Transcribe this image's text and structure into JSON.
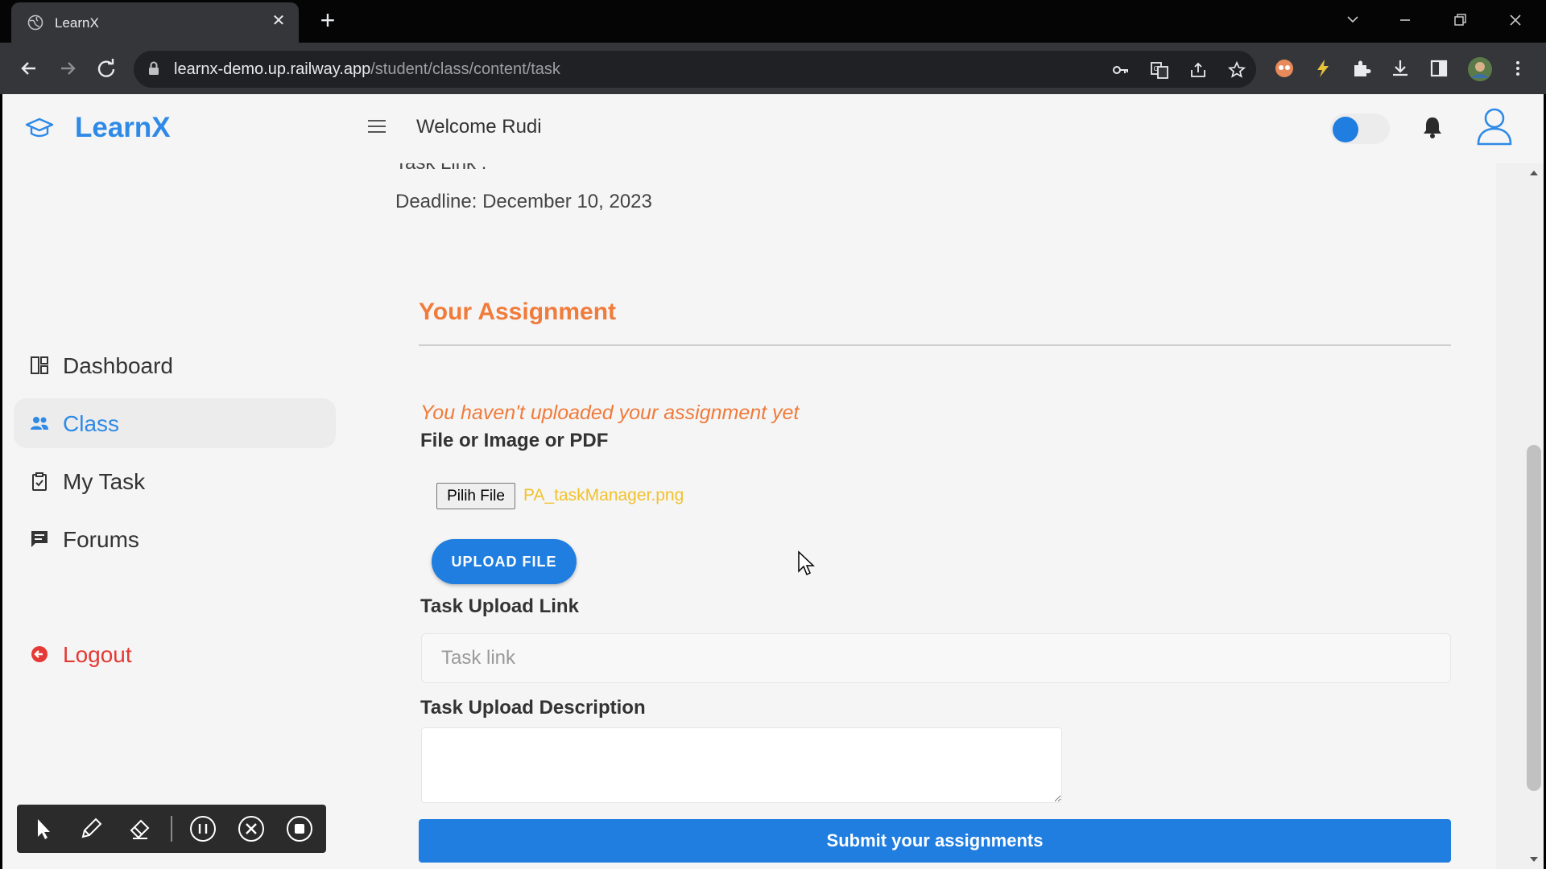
{
  "browser": {
    "tab_title": "LearnX",
    "tab_close": "✕",
    "new_tab": "+",
    "url_host": "learnx-demo.up.railway.app",
    "url_path": "/student/class/content/task"
  },
  "app": {
    "logo_text": "LearnX",
    "welcome": "Welcome Rudi",
    "accent_color": "#2e8ae6",
    "orange_color": "#f07b3a"
  },
  "sidebar": {
    "items": [
      {
        "label": "Dashboard",
        "icon": "dashboard-icon"
      },
      {
        "label": "Class",
        "icon": "users-icon",
        "active": true
      },
      {
        "label": "My Task",
        "icon": "clipboard-icon"
      },
      {
        "label": "Forums",
        "icon": "chat-icon"
      },
      {
        "label": "Logout",
        "icon": "logout-icon"
      }
    ]
  },
  "main": {
    "task_link_partial": "Task Link :",
    "deadline": "Deadline: December 10, 2023",
    "assignment_title": "Your Assignment",
    "not_uploaded": "You haven't uploaded your assignment yet",
    "file_label": "File or Image or PDF",
    "choose_file_label": "Pilih File",
    "file_name": "PA_taskManager.png",
    "upload_button": "UPLOAD FILE",
    "link_label": "Task Upload Link",
    "link_placeholder": "Task link",
    "description_label": "Task Upload Description",
    "submit_button": "Submit your assignments"
  }
}
